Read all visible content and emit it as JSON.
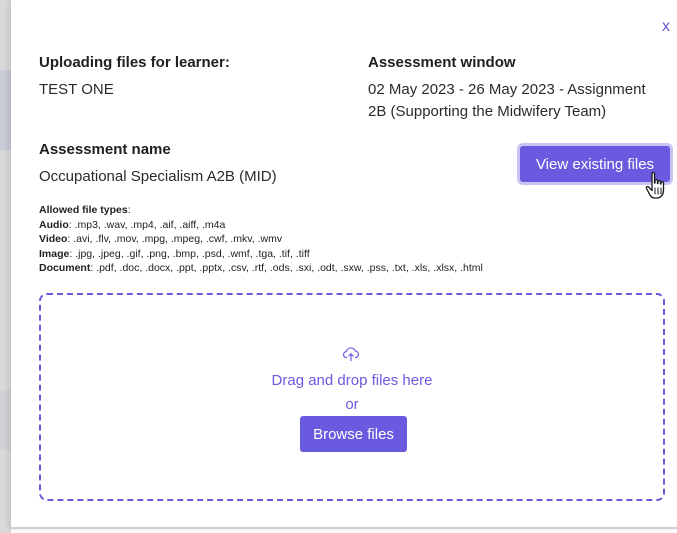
{
  "dialog": {
    "close_label": "x",
    "learner_label": "Uploading files for learner:",
    "learner_value": "TEST ONE",
    "window_label": "Assessment window",
    "window_value_line1": "02 May 2023 - 26 May 2023 - Assignment",
    "window_value_line2": "2B (Supporting the Midwifery Team)",
    "assessment_label": "Assessment name",
    "assessment_value": "Occupational Specialism A2B (MID)",
    "view_button_label": "View existing files"
  },
  "allowed_types": {
    "heading": "Allowed file types",
    "heading_suffix": ":",
    "audio_label": "Audio",
    "audio_value": ": .mp3, .wav, .mp4, .aif, .aiff, .m4a",
    "video_label": "Video",
    "video_value": ": .avi, .flv, .mov, .mpg, .mpeg, .cwf, .mkv, .wmv",
    "image_label": "Image",
    "image_value": ": .jpg, .jpeg, .gif, .png, .bmp, .psd, .wmf, .tga, .tif, .tiff",
    "document_label": "Document",
    "document_value": ": .pdf, .doc, .docx, .ppt, .pptx, .csv, .rtf, .ods, .sxi, .odt, .sxw, .pss, .txt, .xls, .xlsx, .html"
  },
  "dropzone": {
    "icon": "cloud-upload-icon",
    "drag_text": "Drag and drop files here",
    "or_text": "or",
    "browse_label": "Browse files"
  },
  "colors": {
    "accent": "#6a5adf",
    "accent_focus_ring": "#c9c3f5"
  }
}
